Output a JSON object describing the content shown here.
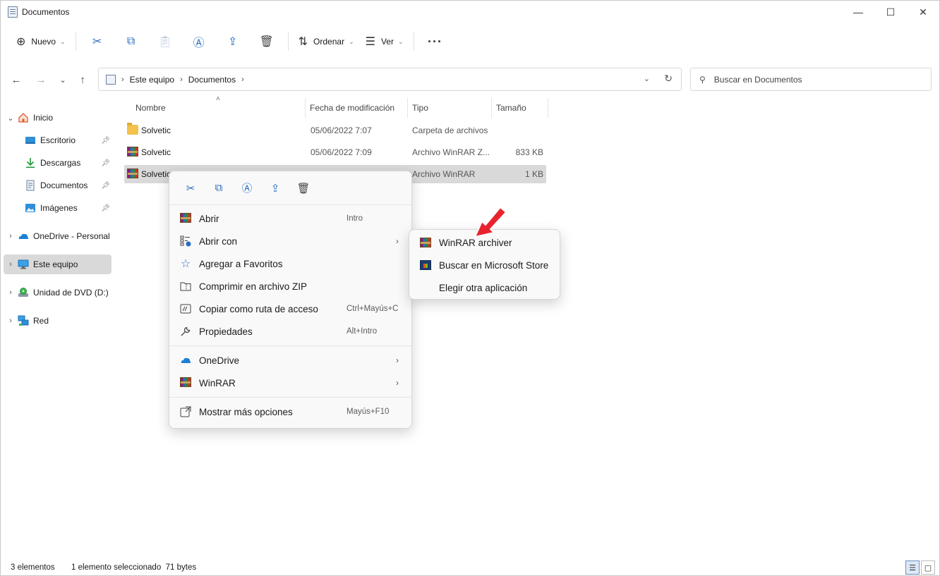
{
  "window": {
    "title": "Documentos",
    "controls": {
      "minimize": "—",
      "maximize": "☐",
      "close": "✕"
    }
  },
  "toolbar": {
    "new_label": "Nuevo",
    "sort_label": "Ordenar",
    "view_label": "Ver",
    "more": "···",
    "icons": [
      "new-icon",
      "cut-icon",
      "copy-icon",
      "paste-icon",
      "rename-icon",
      "share-icon",
      "delete-icon",
      "sort-icon",
      "view-icon",
      "more-icon"
    ]
  },
  "address": {
    "crumbs": [
      "Este equipo",
      "Documentos"
    ]
  },
  "search": {
    "placeholder": "Buscar en Documentos"
  },
  "sidebar": {
    "items": [
      {
        "label": "Inicio",
        "icon": "home-icon",
        "pinned": false
      },
      {
        "label": "Escritorio",
        "icon": "desktop-icon",
        "pinned": true
      },
      {
        "label": "Descargas",
        "icon": "download-icon",
        "pinned": true
      },
      {
        "label": "Documentos",
        "icon": "documents-icon",
        "pinned": true
      },
      {
        "label": "Imágenes",
        "icon": "pictures-icon",
        "pinned": true
      },
      {
        "label": "OneDrive - Personal",
        "icon": "onedrive-icon",
        "pinned": false
      },
      {
        "label": "Este equipo",
        "icon": "computer-icon",
        "pinned": false,
        "selected": true
      },
      {
        "label": "Unidad de DVD (D:)",
        "icon": "dvd-icon",
        "pinned": false
      },
      {
        "label": "Red",
        "icon": "network-icon",
        "pinned": false
      }
    ]
  },
  "filelist": {
    "columns": [
      "Nombre",
      "Fecha de modificación",
      "Tipo",
      "Tamaño"
    ],
    "rows": [
      {
        "name": "Solvetic",
        "date": "05/06/2022 7:07",
        "type": "Carpeta de archivos",
        "size": "",
        "icon": "folder-icon"
      },
      {
        "name": "Solvetic",
        "date": "05/06/2022 7:09",
        "type": "Archivo WinRAR Z...",
        "size": "833 KB",
        "icon": "winrar-icon"
      },
      {
        "name": "Solvetic",
        "date": "",
        "type": "Archivo WinRAR",
        "size": "1 KB",
        "icon": "winrar-icon",
        "selected": true
      }
    ]
  },
  "context_menu": {
    "quick_actions": [
      "cut-icon",
      "copy-icon",
      "rename-icon",
      "share-icon",
      "delete-icon"
    ],
    "items": [
      {
        "label": "Abrir",
        "shortcut": "Intro",
        "icon": "winrar-icon"
      },
      {
        "label": "Abrir con",
        "shortcut": "",
        "icon": "open-with-icon",
        "submenu": true
      },
      {
        "label": "Agregar a Favoritos",
        "shortcut": "",
        "icon": "star-icon"
      },
      {
        "label": "Comprimir en archivo ZIP",
        "shortcut": "",
        "icon": "zip-icon"
      },
      {
        "label": "Copiar como ruta de acceso",
        "shortcut": "Ctrl+Mayús+C",
        "icon": "path-icon"
      },
      {
        "label": "Propiedades",
        "shortcut": "Alt+Intro",
        "icon": "wrench-icon"
      },
      {
        "label": "OneDrive",
        "shortcut": "",
        "icon": "onedrive-icon",
        "submenu": true
      },
      {
        "label": "WinRAR",
        "shortcut": "",
        "icon": "winrar-icon",
        "submenu": true
      },
      {
        "label": "Mostrar más opciones",
        "shortcut": "Mayús+F10",
        "icon": "more-options-icon"
      }
    ]
  },
  "submenu": {
    "items": [
      {
        "label": "WinRAR archiver",
        "icon": "winrar-icon"
      },
      {
        "label": "Buscar en Microsoft Store",
        "icon": "store-icon"
      },
      {
        "label": "Elegir otra aplicación",
        "icon": ""
      }
    ]
  },
  "statusbar": {
    "count": "3 elementos",
    "selection": "1 elemento seleccionado  71 bytes"
  },
  "colors": {
    "accent": "#2a6cbf",
    "selection": "#d9d9d9",
    "annotation_arrow": "#e8232d"
  }
}
